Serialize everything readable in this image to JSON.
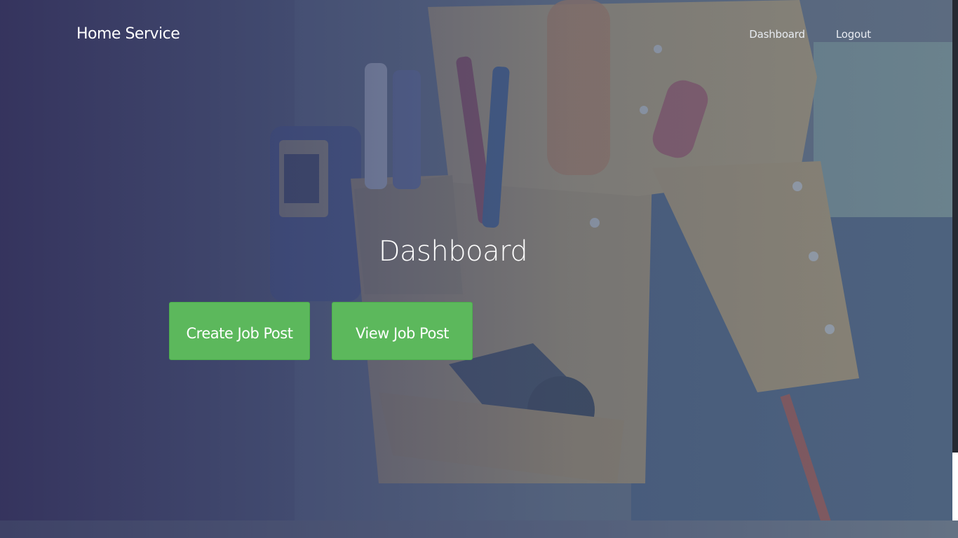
{
  "navbar": {
    "brand": "Home Service",
    "links": [
      {
        "label": "Dashboard"
      },
      {
        "label": "Logout"
      }
    ]
  },
  "main": {
    "title": "Dashboard",
    "buttons": {
      "create": "Create Job Post",
      "view": "View Job Post"
    }
  },
  "colors": {
    "button_green": "#5cb85c",
    "overlay": "#3a446e",
    "text": "#ffffff"
  },
  "background": {
    "subject": "tool-belt-photo"
  }
}
